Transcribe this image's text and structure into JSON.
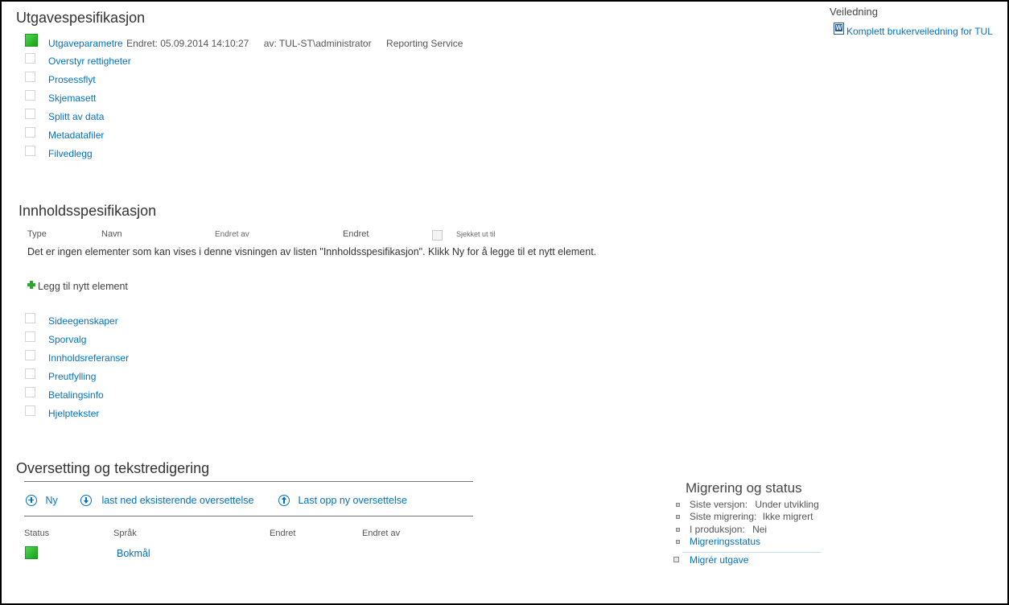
{
  "utgave": {
    "title": "Utgavespesifikasjon",
    "first_item": {
      "label": "Utgaveparametre",
      "changed": "Endret: 05.09.2014 14:10:27",
      "by": "av: TUL-ST\\administrator",
      "service": "Reporting Service"
    },
    "items": [
      "Overstyr rettigheter",
      "Prosessflyt",
      "Skjemasett",
      "Splitt av data",
      "Metadatafiler",
      "Filvedlegg"
    ]
  },
  "veiledning": {
    "title": "Veiledning",
    "link": "Komplett brukerveiledning for TUL",
    "doc_icon_letter": "W"
  },
  "innhold": {
    "title": "Innholdsspesifikasjon",
    "columns": [
      "Type",
      "Navn",
      "Endret av",
      "Endret",
      "Sjekket ut til"
    ],
    "empty_message": "Det er ingen elementer som kan vises i denne visningen av listen \"Innholdsspesifikasjon\". Klikk Ny for å legge til et nytt element.",
    "add_item": "Legg til nytt element",
    "items": [
      "Sideegenskaper",
      "Sporvalg",
      "Innholdsreferanser",
      "Preutfylling",
      "Betalingsinfo",
      "Hjelptekster"
    ]
  },
  "oversetting": {
    "title": "Oversetting og tekstredigering",
    "actions": {
      "new": "Ny",
      "download": "last ned eksisterende oversettelse",
      "upload": "Last opp ny oversettelse"
    },
    "columns": [
      "Status",
      "Språk",
      "Endret",
      "Endret av"
    ],
    "rows": [
      {
        "language": "Bokmål"
      }
    ]
  },
  "migrering": {
    "title": "Migrering og status",
    "lines": [
      {
        "label": "Siste versjon:",
        "value": "Under utvikling"
      },
      {
        "label": "Siste migrering:",
        "value": "Ikke migrert"
      },
      {
        "label": "I produksjon:",
        "value": "Nei"
      }
    ],
    "status_link": "Migreringsstatus",
    "migrate_link": "Migrér utgave"
  },
  "colors": {
    "link": "#0072c6",
    "status_green": "#22b022",
    "add_icon_green": "#2fa52f"
  }
}
